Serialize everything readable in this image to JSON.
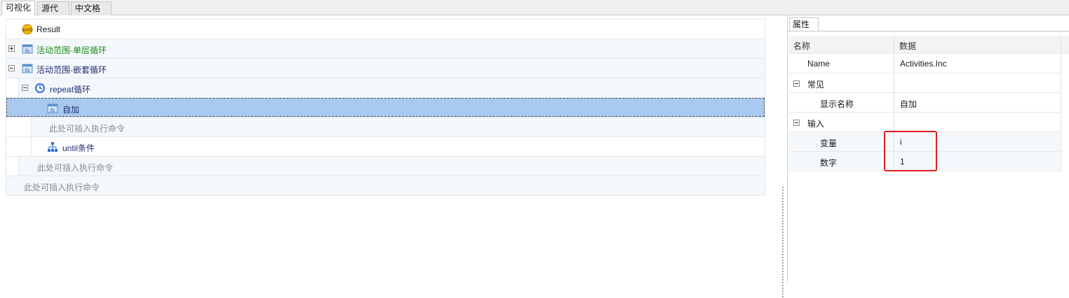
{
  "tabs": [
    "可视化",
    "源代码",
    "中文格式"
  ],
  "tree": {
    "result_label": "Result",
    "scope_single": "活动范围-单层循环",
    "scope_nested": "活动范围-嵌套循环",
    "repeat_label": "repeat循环",
    "inc_label": "自加",
    "insert_hint_1": "此处可插入执行命令",
    "until_label": "until条件",
    "insert_hint_2": "此处可插入执行命令",
    "insert_hint_3": "此处可插入执行命令"
  },
  "properties": {
    "tab_label": "属性",
    "col_name": "名称",
    "col_data": "数据",
    "rows": {
      "name_key": "Name",
      "name_val": "Activities.Inc",
      "group_common": "常见",
      "display_key": "显示名称",
      "display_val": "自加",
      "group_input": "输入",
      "var_key": "变量",
      "var_val": "i",
      "num_key": "数字",
      "num_val": "1"
    }
  },
  "colors": {
    "selected_row": "#a9c9ee",
    "highlight_box": "#e02020",
    "green_text": "#1a8a1a",
    "navy_text": "#1f2f70"
  },
  "icons": {
    "result": "variable-icon",
    "scope": "activity-scope-icon",
    "repeat": "loop-icon",
    "inc": "function-icon",
    "until": "hierarchy-icon"
  }
}
